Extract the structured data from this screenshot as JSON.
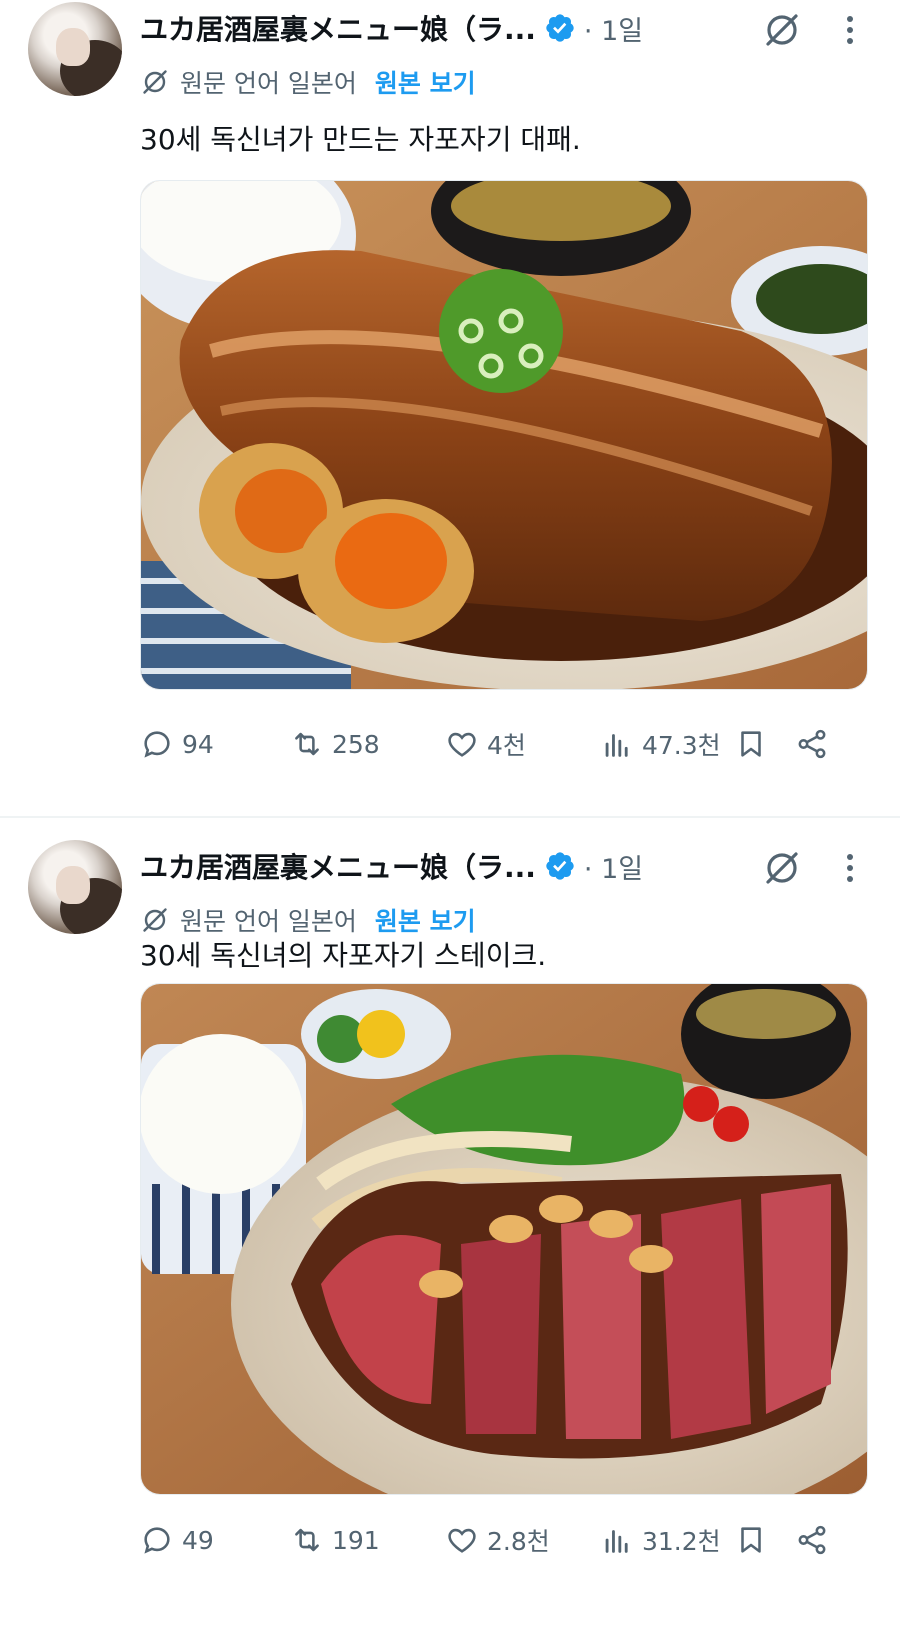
{
  "posts": [
    {
      "author_name": "ユカ居酒屋裏メニュー娘（ラ...",
      "time": "· 1일",
      "translation_note": "원문 언어 일본어",
      "view_original": "원본 보기",
      "text": "30세 독신녀가 만드는 자포자기 대패.",
      "media_description_icon": "braised-pork-belly-photo",
      "metrics": {
        "replies": "94",
        "reposts": "258",
        "likes": "4천",
        "views": "47.3천"
      }
    },
    {
      "author_name": "ユカ居酒屋裏メニュー娘（ラ...",
      "time": "· 1일",
      "translation_note": "원문 언어 일본어",
      "view_original": "원본 보기",
      "text": "30세 독신녀의 자포자기 스테이크.",
      "media_description_icon": "steak-photo",
      "metrics": {
        "replies": "49",
        "reposts": "191",
        "likes": "2.8천",
        "views": "31.2천"
      }
    }
  ],
  "colors": {
    "text": "#0f1419",
    "secondary": "#536471",
    "accent": "#1d9bf0",
    "verified": "#1d9bf0"
  }
}
